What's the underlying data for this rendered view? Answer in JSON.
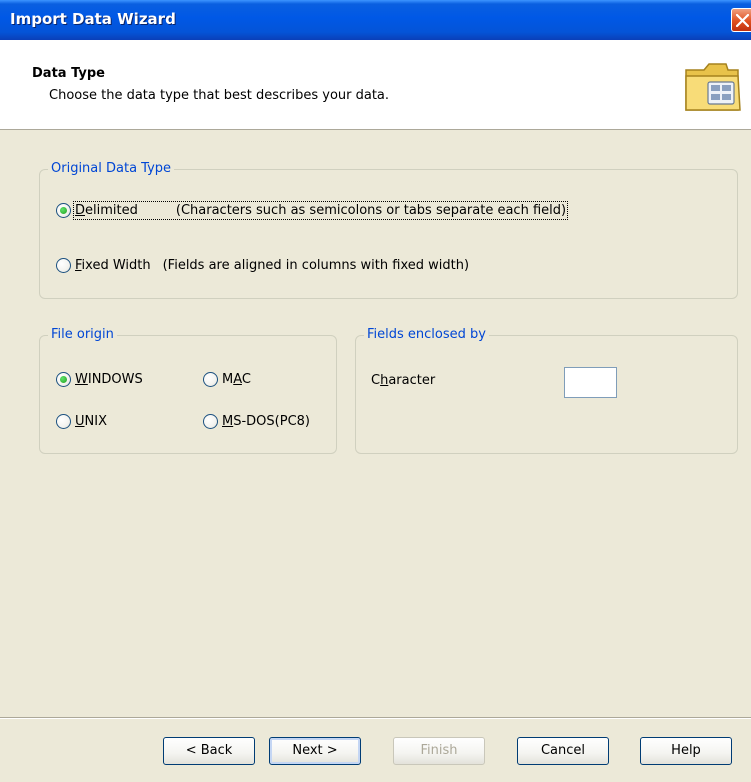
{
  "window": {
    "title": "Import Data Wizard",
    "close_icon": "close-icon",
    "colors": {
      "titlebar": "#0058e6",
      "close": "#e05020",
      "legend": "#0046d5"
    }
  },
  "header": {
    "title": "Data Type",
    "subtitle": "Choose the data type that best describes your data.",
    "icon": "folder-icon"
  },
  "original_data_type": {
    "legend": "Original Data Type",
    "options": [
      {
        "label_underline": "D",
        "label_rest": "elimited",
        "description": "(Characters such as semicolons or tabs separate each field)",
        "checked": true
      },
      {
        "label_underline": "F",
        "label_rest": "ixed Width",
        "description": "(Fields are aligned in columns with fixed width)",
        "checked": false
      }
    ]
  },
  "file_origin": {
    "legend": "File origin",
    "options": [
      {
        "label_pre": "",
        "label_underline": "W",
        "label_rest": "INDOWS",
        "checked": true
      },
      {
        "label_pre": "M",
        "label_underline": "A",
        "label_rest": "C",
        "checked": false
      },
      {
        "label_pre": "",
        "label_underline": "U",
        "label_rest": "NIX",
        "checked": false
      },
      {
        "label_pre": "",
        "label_underline": "M",
        "label_rest": "S-DOS(PC8)",
        "checked": false
      }
    ]
  },
  "fields_enclosed": {
    "legend": "Fields enclosed by",
    "label_pre": "C",
    "label_underline": "h",
    "label_rest": "aracter",
    "value": ""
  },
  "buttons": {
    "back": "< Back",
    "next": "Next >",
    "finish": "Finish",
    "cancel": "Cancel",
    "help": "Help"
  }
}
